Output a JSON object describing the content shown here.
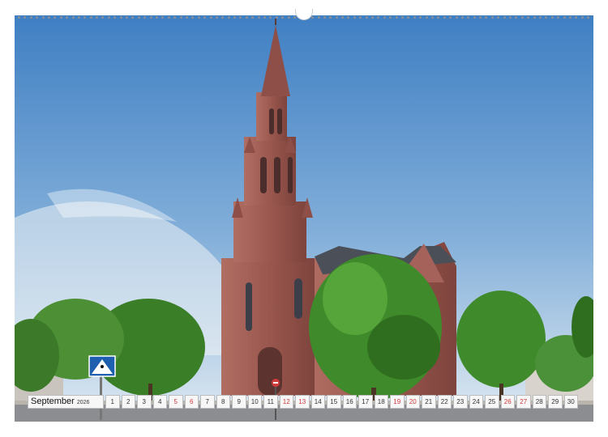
{
  "calendar": {
    "month": "September",
    "year": "2026",
    "days": [
      {
        "n": "1",
        "weekend": false
      },
      {
        "n": "2",
        "weekend": false
      },
      {
        "n": "3",
        "weekend": false
      },
      {
        "n": "4",
        "weekend": false
      },
      {
        "n": "5",
        "weekend": true
      },
      {
        "n": "6",
        "weekend": true
      },
      {
        "n": "7",
        "weekend": false
      },
      {
        "n": "8",
        "weekend": false
      },
      {
        "n": "9",
        "weekend": false
      },
      {
        "n": "10",
        "weekend": false
      },
      {
        "n": "11",
        "weekend": false
      },
      {
        "n": "12",
        "weekend": true
      },
      {
        "n": "13",
        "weekend": true
      },
      {
        "n": "14",
        "weekend": false
      },
      {
        "n": "15",
        "weekend": false
      },
      {
        "n": "16",
        "weekend": false
      },
      {
        "n": "17",
        "weekend": false
      },
      {
        "n": "18",
        "weekend": false
      },
      {
        "n": "19",
        "weekend": true
      },
      {
        "n": "20",
        "weekend": true
      },
      {
        "n": "21",
        "weekend": false
      },
      {
        "n": "22",
        "weekend": false
      },
      {
        "n": "23",
        "weekend": false
      },
      {
        "n": "24",
        "weekend": false
      },
      {
        "n": "25",
        "weekend": false
      },
      {
        "n": "26",
        "weekend": true
      },
      {
        "n": "27",
        "weekend": true
      },
      {
        "n": "28",
        "weekend": false
      },
      {
        "n": "29",
        "weekend": false
      },
      {
        "n": "30",
        "weekend": false
      }
    ]
  },
  "colors": {
    "sky_top": "#3d7fc4",
    "sky_bottom": "#cfe0ee",
    "sandstone": "#9c5a52",
    "tree_green": "#3f8a2a",
    "weekend_red": "#d13b3b"
  },
  "icons": [
    "pedestrian-crossing-sign-icon",
    "no-entry-sign-icon"
  ]
}
